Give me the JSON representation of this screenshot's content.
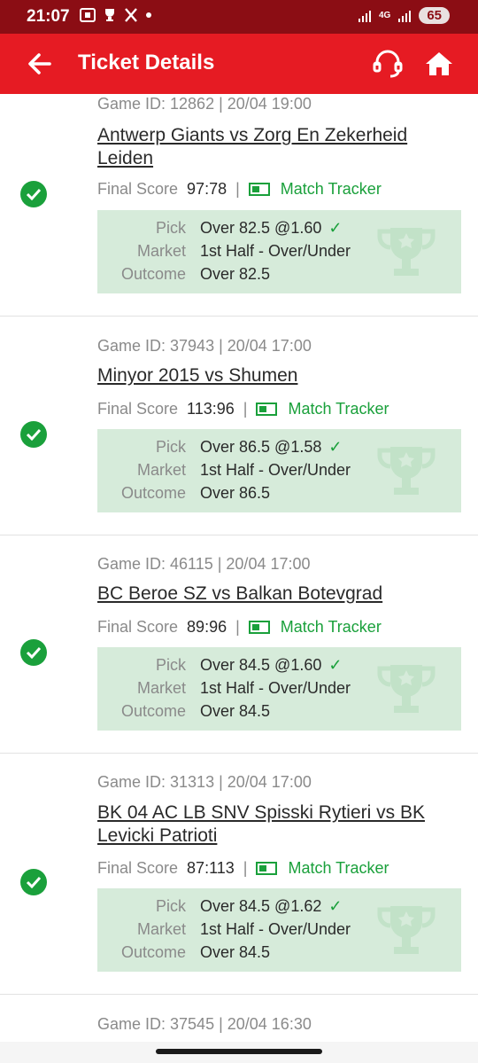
{
  "status": {
    "time": "21:07",
    "network": "4G",
    "battery": "65"
  },
  "header": {
    "title": "Ticket Details"
  },
  "colors": {
    "brand": "#e61b23",
    "status_bar": "#8b0d14",
    "win_green": "#1aa03b",
    "pick_bg": "#d6ebda"
  },
  "labels": {
    "final_score": "Final Score",
    "match_tracker": "Match Tracker",
    "pick": "Pick",
    "market": "Market",
    "outcome": "Outcome"
  },
  "tickets": [
    {
      "game_id": "Game ID: 12862 | 20/04 19:00",
      "match": "Antwerp Giants vs Zorg En Zekerheid Leiden",
      "score": "97:78",
      "pick": "Over 82.5 @1.60",
      "market": "1st Half - Over/Under",
      "outcome": "Over 82.5"
    },
    {
      "game_id": "Game ID: 37943 | 20/04 17:00",
      "match": "Minyor 2015 vs Shumen",
      "score": "113:96",
      "pick": "Over 86.5 @1.58",
      "market": "1st Half - Over/Under",
      "outcome": "Over 86.5"
    },
    {
      "game_id": "Game ID: 46115 | 20/04 17:00",
      "match": "BC Beroe SZ vs Balkan Botevgrad",
      "score": "89:96",
      "pick": "Over 84.5 @1.60",
      "market": "1st Half - Over/Under",
      "outcome": "Over 84.5"
    },
    {
      "game_id": "Game ID: 31313 | 20/04 17:00",
      "match": "BK 04 AC LB SNV Spisski Rytieri vs BK Levicki Patrioti",
      "score": "87:113",
      "pick": "Over 84.5 @1.62",
      "market": "1st Half - Over/Under",
      "outcome": "Over 84.5"
    },
    {
      "game_id": "Game ID: 37545 | 20/04 16:30"
    }
  ]
}
